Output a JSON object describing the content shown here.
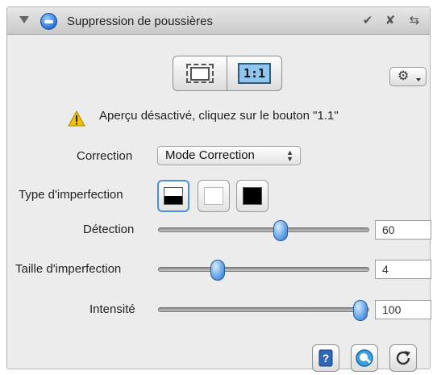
{
  "window": {
    "title": "Suppression de poussières",
    "title_icon": "retouch-icon",
    "header_buttons": [
      "checkmark-icon",
      "close-icon",
      "reset-icon"
    ]
  },
  "toolbar": {
    "view_modes": [
      {
        "name": "marquee-icon",
        "label": ""
      },
      {
        "name": "one-to-one",
        "label": "1:1",
        "active": true
      }
    ],
    "gear_menu": "gear-icon"
  },
  "warning": {
    "icon": "warning-icon",
    "text": "Aperçu désactivé, cliquez sur le bouton \"1.1\""
  },
  "correction": {
    "label": "Correction",
    "value": "Mode Correction"
  },
  "imperfection_type": {
    "label": "Type d'imperfection",
    "options": [
      {
        "name": "half-black-swatch-icon",
        "selected": true
      },
      {
        "name": "white-swatch-icon",
        "selected": false
      },
      {
        "name": "black-swatch-icon",
        "selected": false
      }
    ]
  },
  "sliders": [
    {
      "label": "Détection",
      "value": "60",
      "fraction": 0.58
    },
    {
      "label": "Taille d'imperfection",
      "value": "4",
      "fraction": 0.28
    },
    {
      "label": "Intensité",
      "value": "100",
      "fraction": 0.96
    }
  ],
  "footer_buttons": [
    "help-icon",
    "loupe-icon",
    "refresh-icon"
  ],
  "colors": {
    "accent": "#4a90e0",
    "panel": "#ececec",
    "warning": "#f2c200"
  }
}
